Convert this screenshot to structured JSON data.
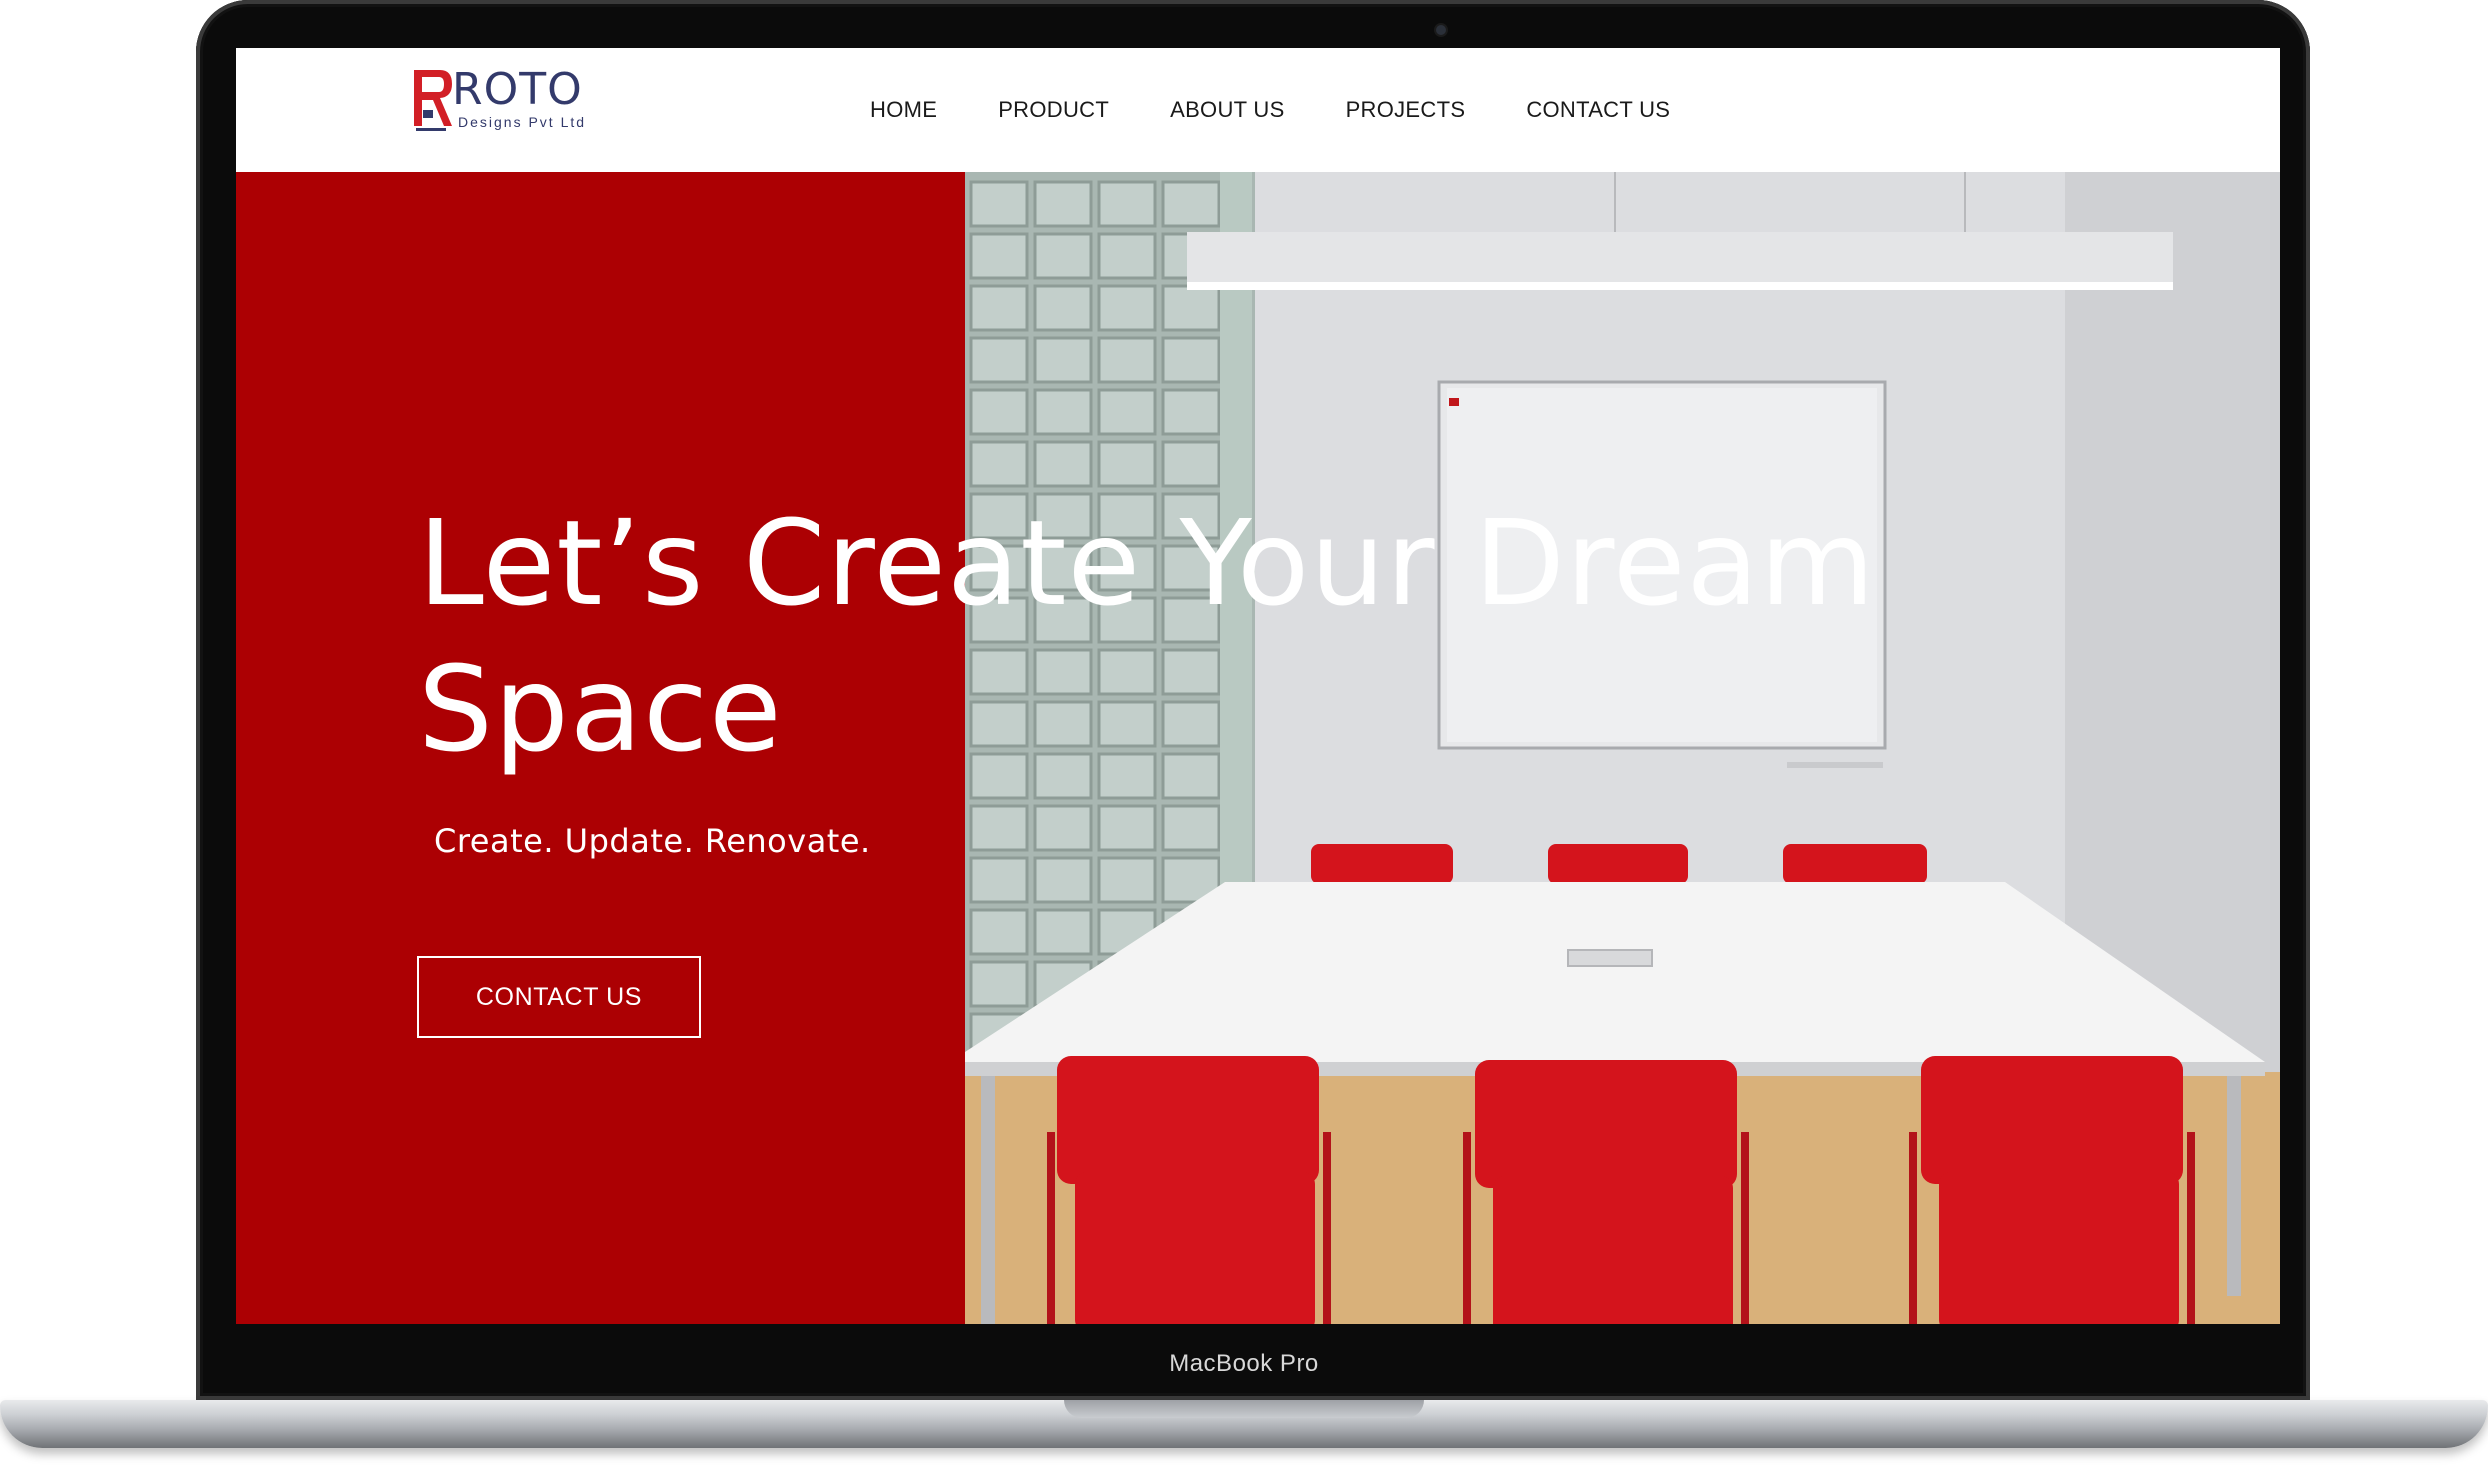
{
  "brand": {
    "logo_word": "ROTO",
    "logo_sub": "Designs Pvt Ltd",
    "primary_color": "#ac0003",
    "logo_color": "#333a6b"
  },
  "nav": {
    "items": [
      {
        "label": "HOME"
      },
      {
        "label": "PRODUCT"
      },
      {
        "label": "ABOUT US"
      },
      {
        "label": "PROJECTS"
      },
      {
        "label": "CONTACT US"
      }
    ]
  },
  "hero": {
    "title_line1": "Let’s Create Your Dream",
    "title_line2": "Space",
    "tagline": "Create. Update. Renovate.",
    "cta_label": "CONTACT US"
  },
  "device": {
    "label": "MacBook Pro"
  }
}
